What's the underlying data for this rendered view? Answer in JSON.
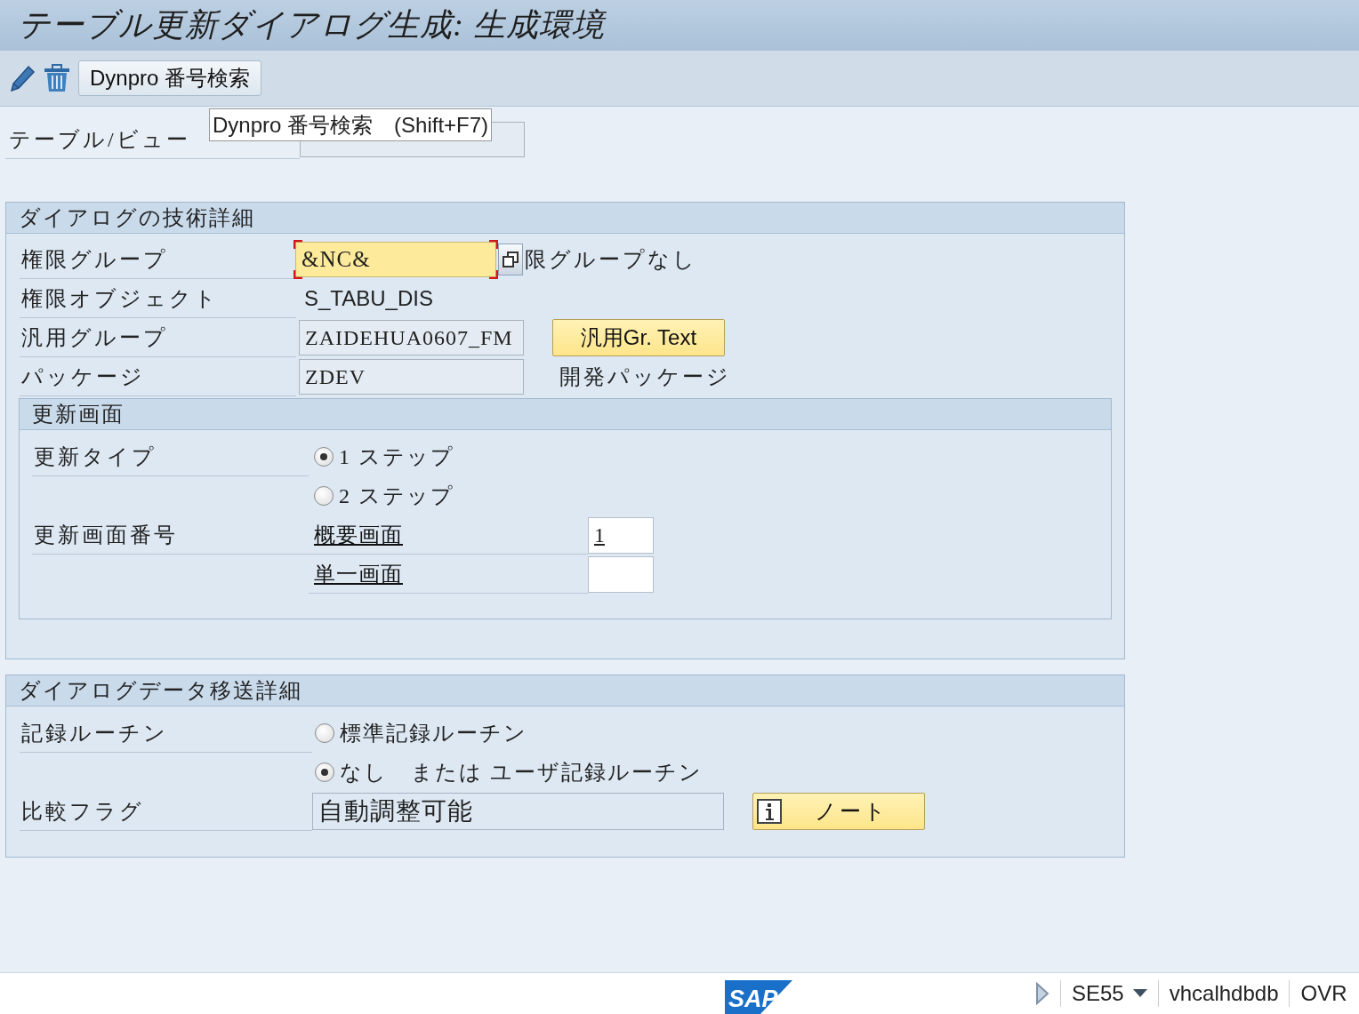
{
  "window": {
    "title": "テーブル更新ダイアログ生成: 生成環境"
  },
  "toolbar": {
    "button": "Dynpro 番号検索"
  },
  "tooltip": "Dynpro 番号検索　(Shift+F7)",
  "table_view": {
    "label": "テーブル/ビュー"
  },
  "technical_details": {
    "title": "ダイアログの技術詳細",
    "auth_group": {
      "label": "権限グループ",
      "value": "&NC&",
      "focused": true,
      "description": "限グループなし"
    },
    "auth_object": {
      "label": "権限オブジェクト",
      "value": "S_TABU_DIS"
    },
    "function_group": {
      "label": "汎用グループ",
      "value": "ZAIDEHUA0607_FM",
      "button": "汎用Gr. Text"
    },
    "package": {
      "label": "パッケージ",
      "value": "ZDEV",
      "description": "開発パッケージ"
    },
    "update_screens": {
      "title": "更新画面",
      "update_type": {
        "label": "更新タイプ",
        "options": [
          {
            "label": "1 ステップ",
            "selected": true
          },
          {
            "label": "2 ステップ",
            "selected": false
          }
        ]
      },
      "screen_number": {
        "label": "更新画面番号",
        "rows": [
          {
            "link": "概要画面",
            "value": "1"
          },
          {
            "link": "単一画面"
          }
        ]
      }
    }
  },
  "data_transfer": {
    "title": "ダイアログデータ移送詳細",
    "recording_routine": {
      "label": "記録ルーチン",
      "options": [
        {
          "label": "標準記録ルーチン",
          "selected": false
        },
        {
          "label": "なし　または ユーザ記録ルーチン",
          "selected": true
        }
      ]
    },
    "compare_flag": {
      "label": "比較フラグ",
      "value": "自動調整可能",
      "button": "ノート"
    }
  },
  "status_bar": {
    "logo": "SAP",
    "transaction": "SE55",
    "system": "vhcalhdbdb",
    "mode": "OVR"
  }
}
